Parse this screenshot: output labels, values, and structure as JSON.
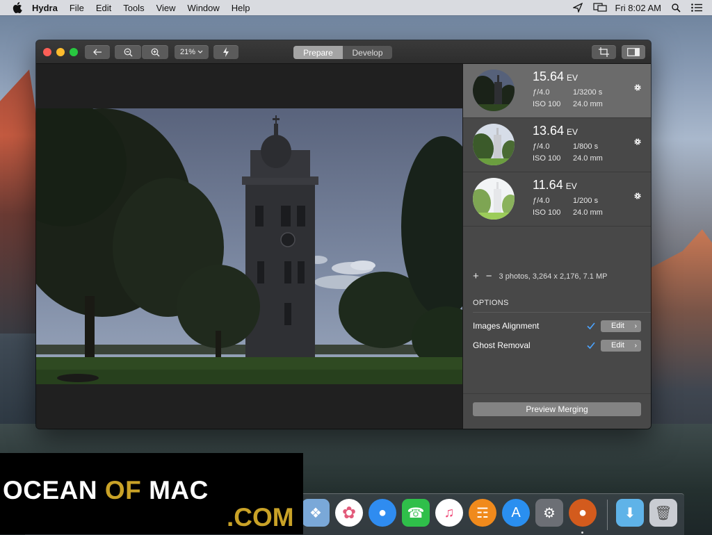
{
  "menubar": {
    "app_name": "Hydra",
    "menus": [
      "File",
      "Edit",
      "Tools",
      "View",
      "Window",
      "Help"
    ],
    "clock": "Fri 8:02 AM"
  },
  "toolbar": {
    "zoom_level": "21%",
    "tabs": [
      "Prepare",
      "Develop"
    ],
    "active_tab": "Prepare"
  },
  "photos": [
    {
      "ev": "15.64",
      "ev_unit": "EV",
      "aperture": "ƒ/4.0",
      "shutter": "1/3200 s",
      "iso": "ISO 100",
      "focal": "24.0 mm",
      "selected": true
    },
    {
      "ev": "13.64",
      "ev_unit": "EV",
      "aperture": "ƒ/4.0",
      "shutter": "1/800 s",
      "iso": "ISO 100",
      "focal": "24.0 mm",
      "selected": false
    },
    {
      "ev": "11.64",
      "ev_unit": "EV",
      "aperture": "ƒ/4.0",
      "shutter": "1/200 s",
      "iso": "ISO 100",
      "focal": "24.0 mm",
      "selected": false
    }
  ],
  "summary": {
    "add": "+",
    "remove": "−",
    "text": "3 photos, 3,264 x 2,176, 7.1 MP"
  },
  "options": {
    "heading": "OPTIONS",
    "items": [
      {
        "label": "Images Alignment",
        "checked": true,
        "button": "Edit"
      },
      {
        "label": "Ghost Removal",
        "checked": true,
        "button": "Edit"
      }
    ]
  },
  "preview_button": "Preview Merging",
  "watermark": {
    "part1": "OCEAN ",
    "part2": "OF",
    "part3": " MAC",
    "part4": ".COM"
  },
  "colors": {
    "accent_check": "#4aa3ff",
    "watermark_gold": "#c9a227"
  }
}
